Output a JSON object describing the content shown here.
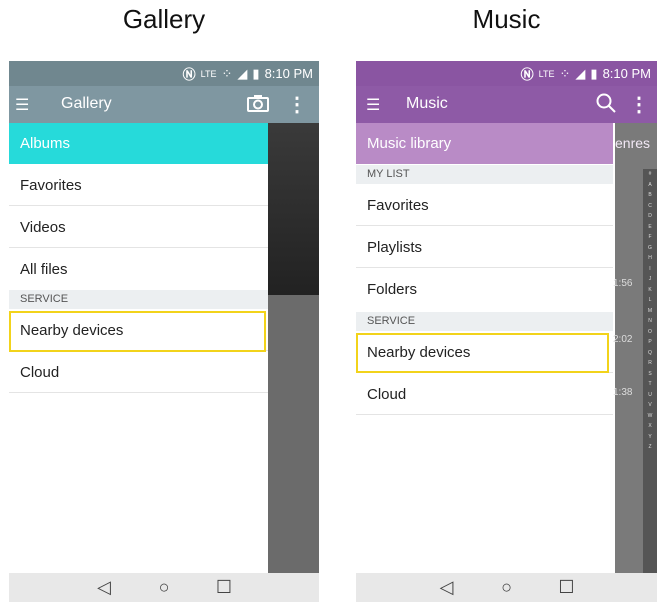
{
  "gallery": {
    "caption": "Gallery",
    "status": {
      "lte": "LTE",
      "time": "8:10 PM"
    },
    "toolbar": {
      "title": "Gallery"
    },
    "drawer": {
      "albums": "Albums",
      "items": [
        "Favorites",
        "Videos",
        "All files"
      ],
      "section": "SERVICE",
      "service_items": [
        "Nearby devices",
        "Cloud"
      ]
    },
    "colors": {
      "toolbar": "#7f97a1",
      "status": "#70878f",
      "selected": "#26dada",
      "highlight": "#f2d31b"
    }
  },
  "music": {
    "caption": "Music",
    "status": {
      "lte": "LTE",
      "time": "8:10 PM"
    },
    "toolbar": {
      "title": "Music"
    },
    "library_label": "Music library",
    "tab_peek": "enres",
    "drawer": {
      "section1": "MY LIST",
      "items": [
        "Favorites",
        "Playlists",
        "Folders"
      ],
      "section2": "SERVICE",
      "service_items": [
        "Nearby devices",
        "Cloud"
      ]
    },
    "durations": [
      "1:56",
      "2:02",
      "1:38"
    ],
    "alphabet": "# A B C D E F G H I J K L M N O P Q R S T U V W X Y Z",
    "colors": {
      "toolbar": "#8e5aa6",
      "status": "#8a55a2",
      "library": "#b98bc6"
    }
  },
  "nav": {
    "back": "back-icon",
    "home": "home-icon",
    "recents": "recents-icon"
  }
}
